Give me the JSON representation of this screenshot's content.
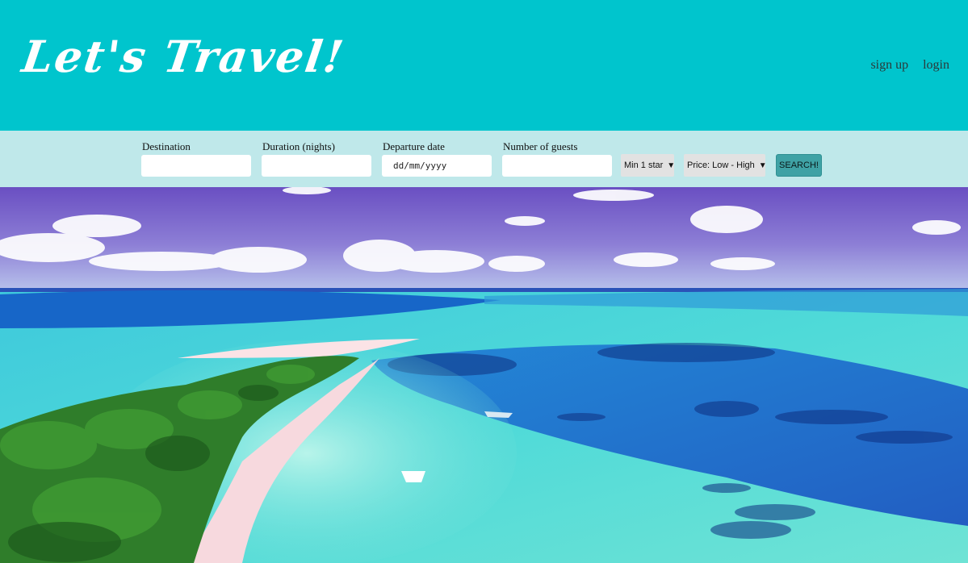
{
  "header": {
    "logo_text": "Let's Travel!",
    "nav": {
      "signup": "sign up",
      "login": "login"
    }
  },
  "search": {
    "destination": {
      "label": "Destination",
      "value": ""
    },
    "duration": {
      "label": "Duration (nights)",
      "value": ""
    },
    "departure": {
      "label": "Departure date",
      "placeholder": "dd/mm/yyyy"
    },
    "guests": {
      "label": "Number of guests",
      "value": ""
    },
    "stars_select": {
      "selected": "Min 1 star"
    },
    "price_select": {
      "selected": "Price: Low - High"
    },
    "submit_label": "SEARCH!"
  },
  "colors": {
    "header_bg": "#00c5cd",
    "search_bar_bg": "#bfe8ea",
    "search_button_bg": "#3fa2a5"
  },
  "hero": {
    "image": "tropical-island-lagoon-photo"
  }
}
